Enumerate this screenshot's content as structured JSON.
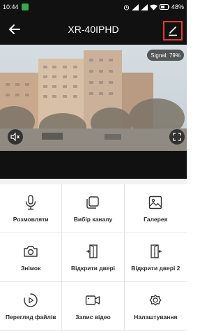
{
  "status_bar": {
    "time": "10:44",
    "battery": "48%"
  },
  "app_bar": {
    "title": "XR-40IPHD"
  },
  "video": {
    "signal": "Signal: 79%"
  },
  "actions": [
    {
      "label": "Розмовляти",
      "icon": "microphone-icon"
    },
    {
      "label": "Вибір каналу",
      "icon": "channel-select-icon"
    },
    {
      "label": "Галерея",
      "icon": "gallery-icon"
    },
    {
      "label": "Знімок",
      "icon": "camera-icon"
    },
    {
      "label": "Відкрити двері",
      "icon": "door-open-icon"
    },
    {
      "label": "Відкрити двері 2",
      "icon": "door-open-2-icon"
    },
    {
      "label": "Перегляд файлів",
      "icon": "playback-icon"
    },
    {
      "label": "Запис відео",
      "icon": "video-record-icon"
    },
    {
      "label": "Налаштування",
      "icon": "settings-icon"
    }
  ],
  "colors": {
    "bar_bg": "#111111",
    "highlight": "#e53935",
    "icon": "#333333"
  }
}
